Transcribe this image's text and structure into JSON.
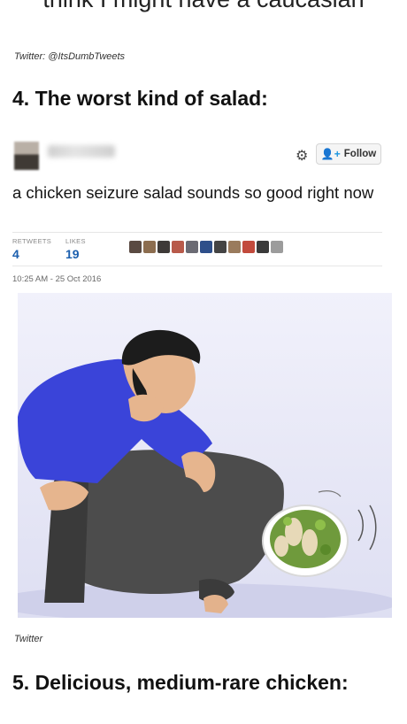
{
  "clipped_heading": "think I might have a caucasian",
  "credit_1": "Twitter: @ItsDumbTweets",
  "item_4_title": "4. The worst kind of salad:",
  "tweet": {
    "follow_label": "Follow",
    "text": "a chicken seizure salad sounds so good right now",
    "retweets_label": "RETWEETS",
    "retweets_count": "4",
    "likes_label": "LIKES",
    "likes_count": "19",
    "timestamp": "10:25 AM - 25 Oct 2016",
    "liker_colors": [
      "#5a4a42",
      "#8c6d4f",
      "#3e3a38",
      "#b85a4a",
      "#6b6b74",
      "#2e4f8a",
      "#444444",
      "#9a7b5d",
      "#c24a3c",
      "#3a3a3a",
      "#9c9c9c"
    ]
  },
  "credit_2": "Twitter",
  "item_5_title": "5. Delicious, medium-rare chicken:",
  "colors": {
    "link_blue": "#1b95e0",
    "shirt_blue": "#3a44d9"
  }
}
